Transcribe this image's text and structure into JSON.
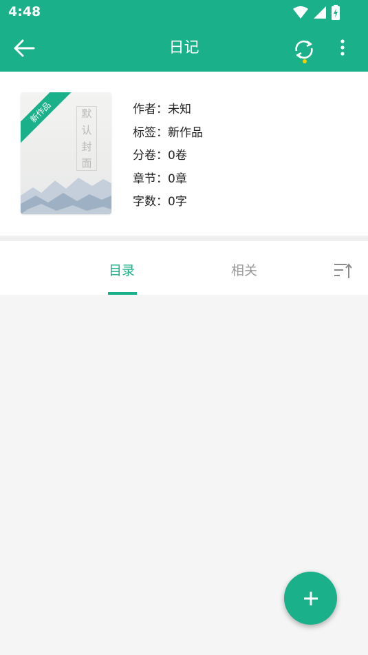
{
  "status_bar": {
    "time": "4:48"
  },
  "app_bar": {
    "title": "日记"
  },
  "book": {
    "cover": {
      "label_chars": [
        "默",
        "认",
        "封",
        "面"
      ],
      "ribbon": "新作品"
    },
    "author": "作者：未知",
    "tags": "标签：新作品",
    "volumes": "分卷：0卷",
    "chapters": "章节：0章",
    "words": "字数：0字"
  },
  "tabs": [
    {
      "label": "目录",
      "active": true
    },
    {
      "label": "相关",
      "active": false
    }
  ],
  "colors": {
    "accent": "#1ab08a",
    "sync_dot": "#f5d000"
  },
  "icons": {
    "back": "arrow-left-icon",
    "sync": "sync-icon",
    "more": "more-vert-icon",
    "sort": "sort-icon",
    "add": "plus-icon"
  }
}
